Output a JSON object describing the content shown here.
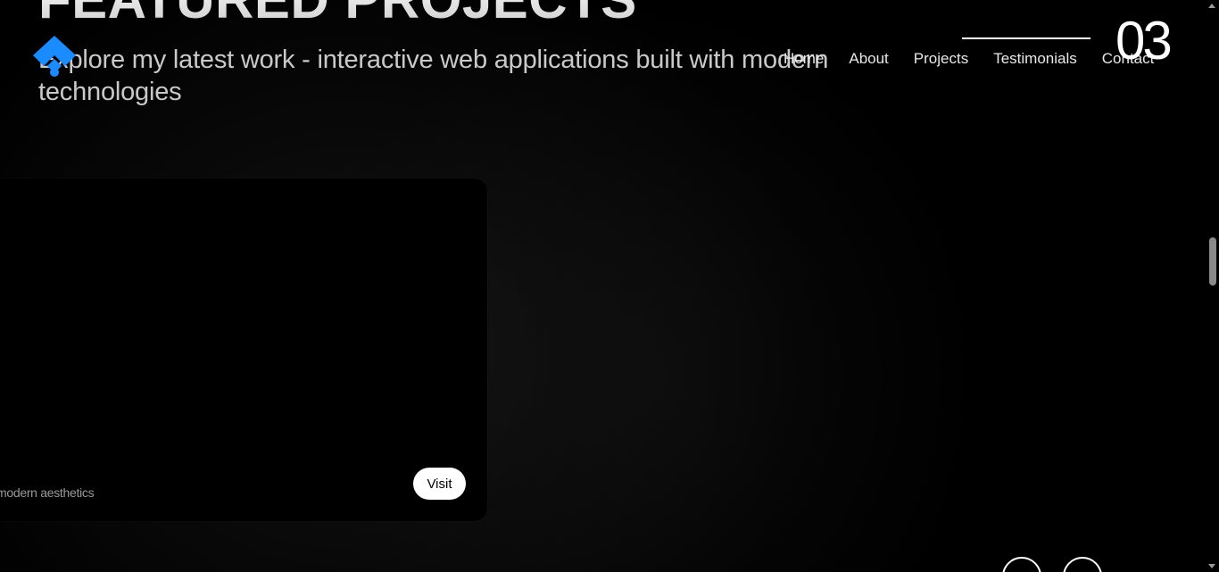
{
  "section": {
    "title": "FEATURED PROJECTS",
    "subtitle": "Explore my latest work - interactive web applications built with modern technologies",
    "number": "03"
  },
  "nav": {
    "items": [
      {
        "label": "Home"
      },
      {
        "label": "About"
      },
      {
        "label": "Projects"
      },
      {
        "label": "Testimonials"
      },
      {
        "label": "Contact"
      }
    ],
    "active": "Testimonials"
  },
  "project": {
    "description_fragment": "modern aesthetics",
    "visit_label": "Visit"
  },
  "colors": {
    "background": "#000000",
    "logo_accent": "#1a8cff",
    "text_primary": "#ffffff",
    "text_secondary": "#c9c9c9"
  },
  "icons": {
    "logo": "logo-icon",
    "carousel_prev": "arrow-left-icon",
    "carousel_next": "arrow-right-icon"
  }
}
